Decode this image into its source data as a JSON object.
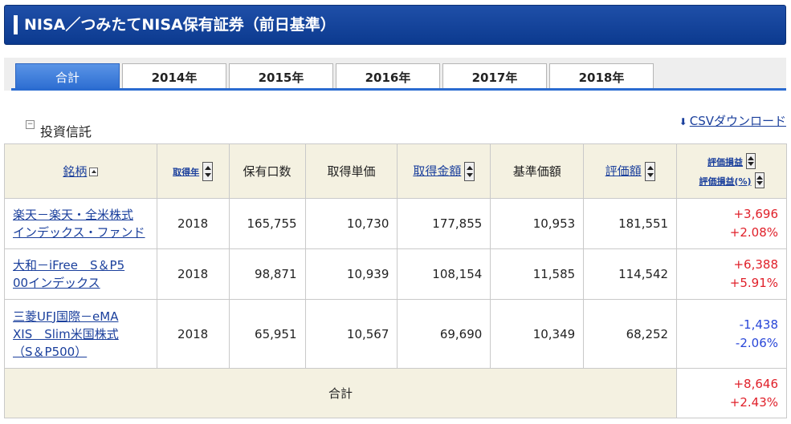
{
  "header": {
    "title": "NISA／つみたてNISA保有証券（前日基準）"
  },
  "tabs": [
    {
      "label": "合計",
      "active": true
    },
    {
      "label": "2014年",
      "active": false
    },
    {
      "label": "2015年",
      "active": false
    },
    {
      "label": "2016年",
      "active": false
    },
    {
      "label": "2017年",
      "active": false
    },
    {
      "label": "2018年",
      "active": false
    }
  ],
  "section": {
    "title": "投資信託",
    "toggle": "−"
  },
  "csv": {
    "label": "CSVダウンロード",
    "icon": "download-icon"
  },
  "table": {
    "headers": {
      "name": "銘柄",
      "year": "取得年",
      "units": "保有口数",
      "unit_cost": "取得単価",
      "cost_amount": "取得金額",
      "base_price": "基準価額",
      "valuation": "評価額",
      "pl": "評価損益",
      "pl_pct": "評価損益(%)"
    },
    "rows": [
      {
        "name_line1": "楽天－楽天・全米株式",
        "name_line2": "インデックス・ファンド",
        "year": "2018",
        "units": "165,755",
        "unit_cost": "10,730",
        "cost_amount": "177,855",
        "base_price": "10,953",
        "valuation": "181,551",
        "pl": "+3,696",
        "pl_pct": "+2.08%"
      },
      {
        "name_line1": "大和－iFree　S＆P5",
        "name_line2": "00インデックス",
        "year": "2018",
        "units": "98,871",
        "unit_cost": "10,939",
        "cost_amount": "108,154",
        "base_price": "11,585",
        "valuation": "114,542",
        "pl": "+6,388",
        "pl_pct": "+5.91%"
      },
      {
        "name_line1": "三菱UFJ国際－eMA",
        "name_line2": "XIS　Slim米国株式",
        "name_line3": "（S＆P500）",
        "year": "2018",
        "units": "65,951",
        "unit_cost": "10,567",
        "cost_amount": "69,690",
        "base_price": "10,349",
        "valuation": "68,252",
        "pl": "-1,438",
        "pl_pct": "-2.06%"
      }
    ],
    "total": {
      "label": "合計",
      "pl": "+8,646",
      "pl_pct": "+2.43%"
    }
  },
  "colors": {
    "header_blue": "#0c3a8f",
    "tab_active": "#2a6bd0",
    "positive": "#e0202a",
    "negative": "#2846d8",
    "table_header_bg": "#f4f1e1"
  }
}
